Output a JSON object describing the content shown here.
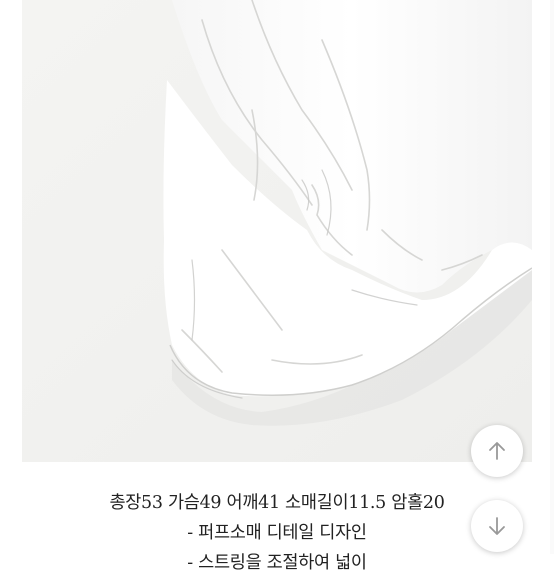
{
  "product_photo": {
    "alt": "product-photo",
    "colors": {
      "wall": "#f1f1ef",
      "fabric": "#ffffff",
      "shadow": "#d9d9d7"
    }
  },
  "description": {
    "lines": [
      "총장53 가슴49 어깨41 소매길이11.5 암홀20",
      "- 퍼프소매 디테일 디자인",
      "- 스트링을 조절하여 넓이"
    ]
  },
  "controls": {
    "scroll_up_icon": "arrow-up-icon",
    "scroll_down_icon": "arrow-down-icon",
    "icon_color": "#999999"
  }
}
